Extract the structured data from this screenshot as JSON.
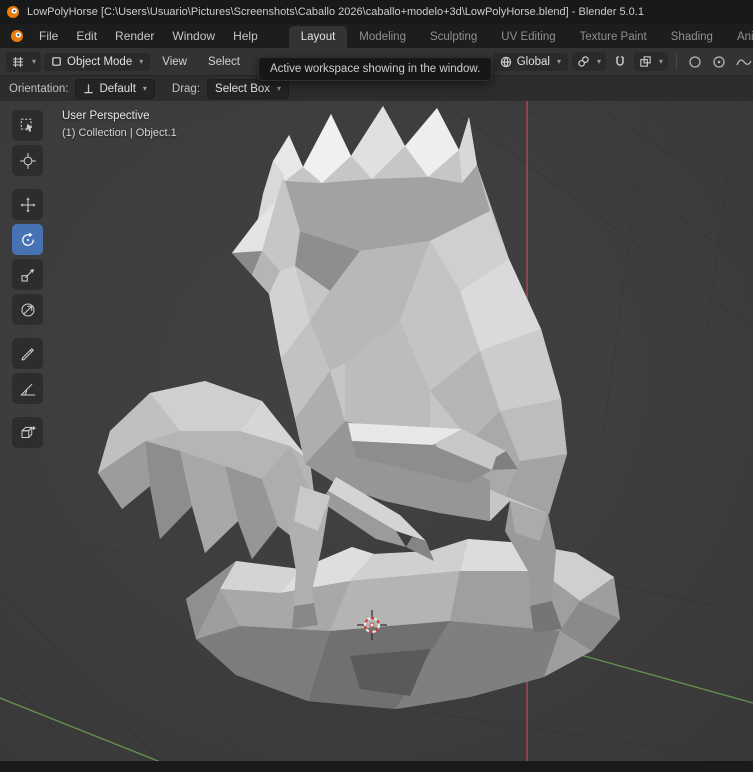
{
  "titlebar": {
    "title": "LowPolyHorse [C:\\Users\\Usuario\\Pictures\\Screenshots\\Caballo 2026\\caballo+modelo+3d\\LowPolyHorse.blend] - Blender 5.0.1"
  },
  "menubar": {
    "items": [
      {
        "label": "File"
      },
      {
        "label": "Edit"
      },
      {
        "label": "Render"
      },
      {
        "label": "Window"
      },
      {
        "label": "Help"
      }
    ],
    "workspaces": [
      {
        "label": "Layout",
        "active": true
      },
      {
        "label": "Modeling",
        "active": false
      },
      {
        "label": "Sculpting",
        "active": false
      },
      {
        "label": "UV Editing",
        "active": false
      },
      {
        "label": "Texture Paint",
        "active": false
      },
      {
        "label": "Shading",
        "active": false
      },
      {
        "label": "Animation",
        "active": false
      }
    ]
  },
  "header": {
    "mode_value": "Object Mode",
    "menus": [
      {
        "label": "View"
      },
      {
        "label": "Select"
      }
    ],
    "orientation_value": "Global"
  },
  "tooltip": {
    "text": "Active workspace showing in the window."
  },
  "tool_settings": {
    "orientation_label": "Orientation:",
    "orientation_value": "Default",
    "drag_label": "Drag:",
    "drag_value": "Select Box"
  },
  "viewport": {
    "perspective_label": "User Perspective",
    "collection_label": "(1) Collection | Object.1"
  },
  "tools": [
    {
      "name": "select-box",
      "active": false
    },
    {
      "name": "cursor",
      "active": false
    },
    {
      "name": "move",
      "active": false
    },
    {
      "name": "rotate",
      "active": true
    },
    {
      "name": "scale",
      "active": false
    },
    {
      "name": "transform",
      "active": false
    },
    {
      "name": "annotate",
      "active": false
    },
    {
      "name": "measure",
      "active": false
    },
    {
      "name": "add-cube",
      "active": false
    }
  ],
  "colors": {
    "accent_blue": "#4772b3",
    "axis_red": "#b64e58",
    "axis_green": "#6fa351",
    "viewport_bg": "#3d3d3d",
    "blender_orange": "#e87d0d"
  }
}
